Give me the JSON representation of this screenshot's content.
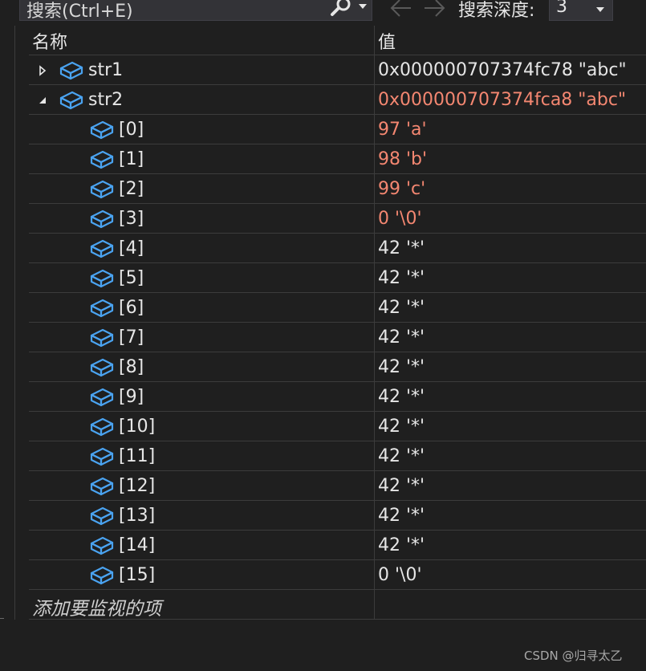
{
  "toolbar": {
    "search_text": "搜索(Ctrl+E)",
    "depth_label": "搜索深度:",
    "depth_value": "3"
  },
  "columns": {
    "name": "名称",
    "value": "值"
  },
  "colors": {
    "background": "#1f1f1f",
    "text": "#e6e6e6",
    "changed_value": "#f48771",
    "icon_blue": "#4aa3f0",
    "grid_line": "#3c3c3c"
  },
  "rows": [
    {
      "name": "str1",
      "value": "0x000000707374fc78 \"abc\"",
      "expander": "collapsed",
      "changed": false
    },
    {
      "name": "str2",
      "value": "0x000000707374fca8 \"abc\"",
      "expander": "expanded",
      "changed": true
    },
    {
      "name": "[0]",
      "value": "97 'a'",
      "changed": true
    },
    {
      "name": "[1]",
      "value": "98 'b'",
      "changed": true
    },
    {
      "name": "[2]",
      "value": "99 'c'",
      "changed": true
    },
    {
      "name": "[3]",
      "value": "0 '\\0'",
      "changed": true
    },
    {
      "name": "[4]",
      "value": "42 '*'",
      "changed": false
    },
    {
      "name": "[5]",
      "value": "42 '*'",
      "changed": false
    },
    {
      "name": "[6]",
      "value": "42 '*'",
      "changed": false
    },
    {
      "name": "[7]",
      "value": "42 '*'",
      "changed": false
    },
    {
      "name": "[8]",
      "value": "42 '*'",
      "changed": false
    },
    {
      "name": "[9]",
      "value": "42 '*'",
      "changed": false
    },
    {
      "name": "[10]",
      "value": "42 '*'",
      "changed": false
    },
    {
      "name": "[11]",
      "value": "42 '*'",
      "changed": false
    },
    {
      "name": "[12]",
      "value": "42 '*'",
      "changed": false
    },
    {
      "name": "[13]",
      "value": "42 '*'",
      "changed": false
    },
    {
      "name": "[14]",
      "value": "42 '*'",
      "changed": false
    },
    {
      "name": "[15]",
      "value": "0 '\\0'",
      "changed": false
    }
  ],
  "add_watch_placeholder": "添加要监视的项",
  "watermark": "CSDN @归寻太乙"
}
